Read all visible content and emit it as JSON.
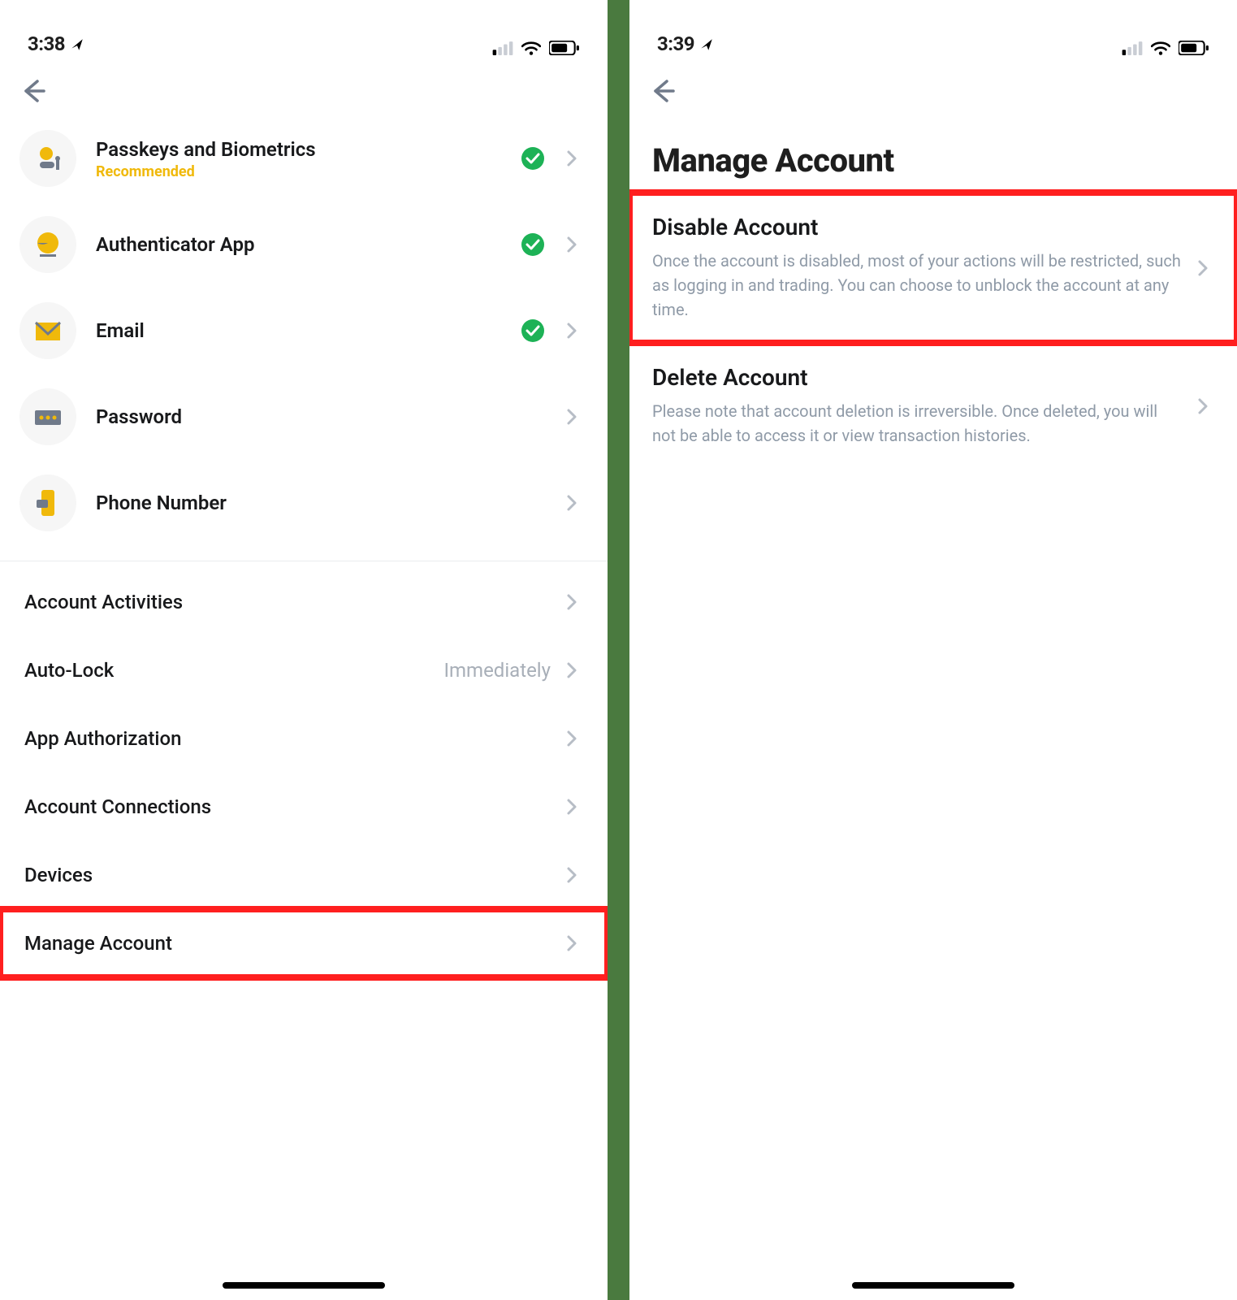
{
  "left": {
    "status": {
      "time": "3:38"
    },
    "security_items": [
      {
        "title": "Passkeys and Biometrics",
        "sub": "Recommended",
        "checked": true,
        "icon": "passkey"
      },
      {
        "title": "Authenticator App",
        "sub": "",
        "checked": true,
        "icon": "authenticator"
      },
      {
        "title": "Email",
        "sub": "",
        "checked": true,
        "icon": "email"
      },
      {
        "title": "Password",
        "sub": "",
        "checked": false,
        "icon": "password"
      },
      {
        "title": "Phone Number",
        "sub": "",
        "checked": false,
        "icon": "phone"
      }
    ],
    "rows": [
      {
        "title": "Account Activities",
        "value": ""
      },
      {
        "title": "Auto-Lock",
        "value": "Immediately"
      },
      {
        "title": "App Authorization",
        "value": ""
      },
      {
        "title": "Account Connections",
        "value": ""
      },
      {
        "title": "Devices",
        "value": ""
      },
      {
        "title": "Manage Account",
        "value": "",
        "highlight": true
      }
    ]
  },
  "right": {
    "status": {
      "time": "3:39"
    },
    "page_title": "Manage Account",
    "items": [
      {
        "title": "Disable Account",
        "desc": "Once the account is disabled, most of your actions will be restricted, such as logging in and trading. You can choose to unblock the account at any time.",
        "highlight": true
      },
      {
        "title": "Delete Account",
        "desc": "Please note that account deletion is irreversible. Once deleted, you will not be able to access it or view transaction histories.",
        "highlight": false
      }
    ]
  }
}
